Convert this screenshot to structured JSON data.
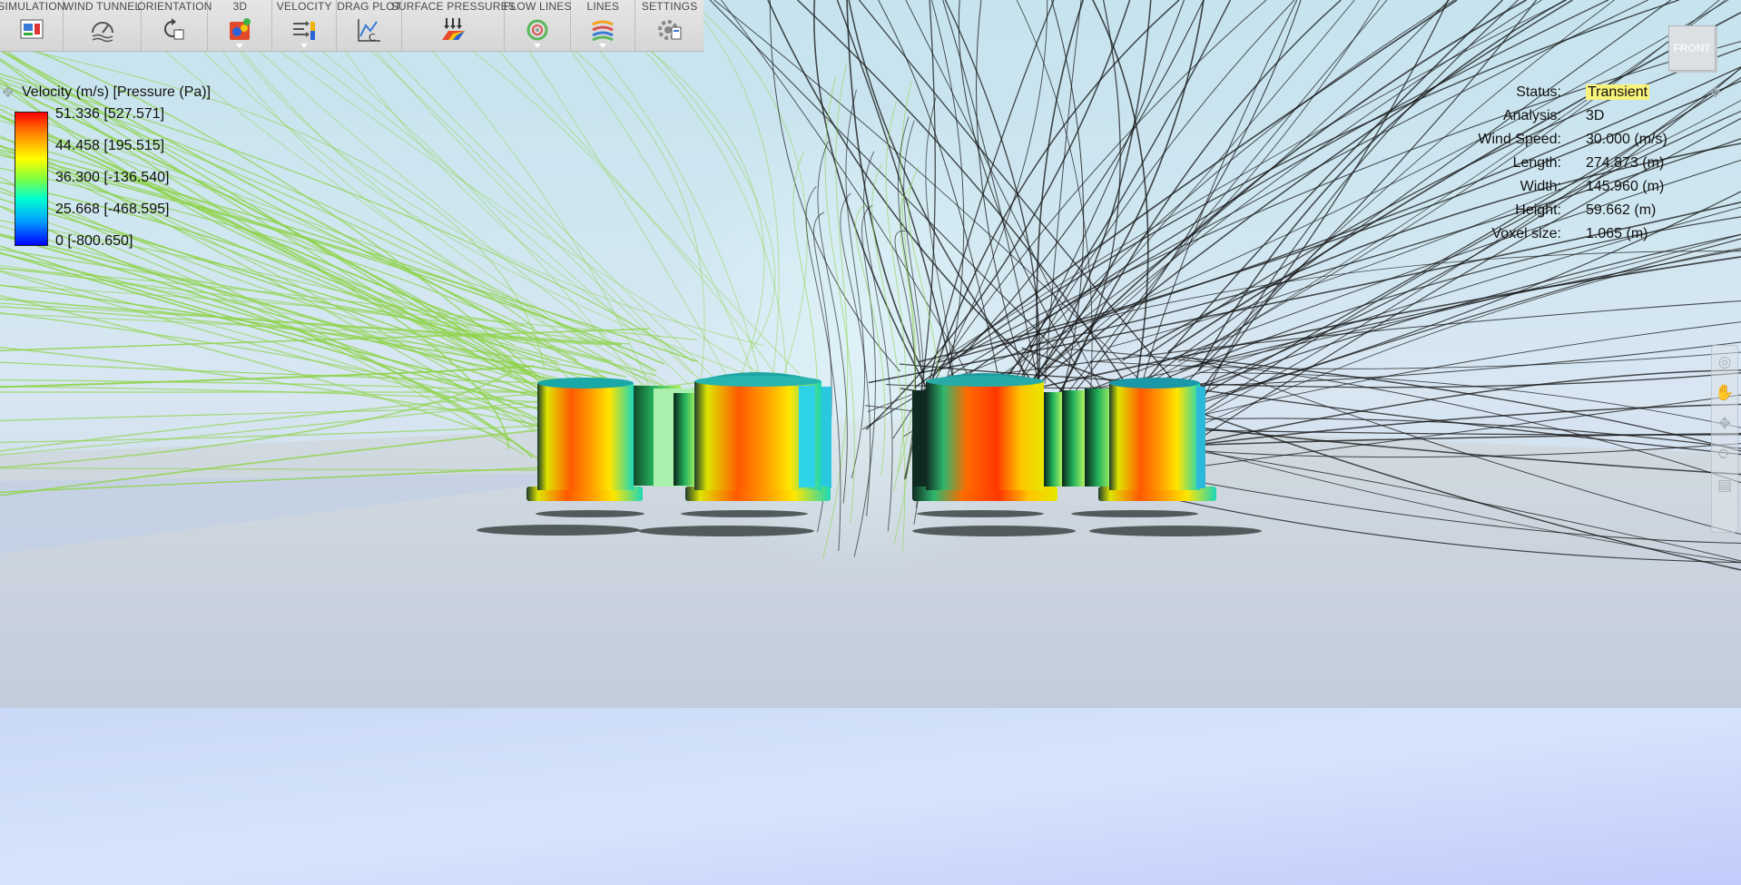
{
  "toolbar": {
    "items": [
      {
        "label": "SIMULATION",
        "icon": "simulation-icon",
        "dropdown": false
      },
      {
        "label": "WIND TUNNEL",
        "icon": "wind-tunnel-icon",
        "dropdown": false
      },
      {
        "label": "ORIENTATION",
        "icon": "orientation-icon",
        "dropdown": false
      },
      {
        "label": "3D",
        "icon": "3d-icon",
        "dropdown": true
      },
      {
        "label": "VELOCITY",
        "icon": "velocity-icon",
        "dropdown": true
      },
      {
        "label": "DRAG PLOT",
        "icon": "drag-plot-icon",
        "dropdown": false
      },
      {
        "label": "SURFACE PRESSURES",
        "icon": "surface-pressures-icon",
        "dropdown": false
      },
      {
        "label": "FLOW LINES",
        "icon": "flow-lines-icon",
        "dropdown": true
      },
      {
        "label": "LINES",
        "icon": "lines-icon",
        "dropdown": true
      },
      {
        "label": "SETTINGS",
        "icon": "settings-icon",
        "dropdown": false
      }
    ]
  },
  "legend": {
    "title": "Velocity (m/s) [Pressure (Pa)]",
    "ticks": [
      "51.336 [527.571]",
      "44.458 [195.515]",
      "36.300 [-136.540]",
      "25.668 [-468.595]",
      "0 [-800.650]"
    ],
    "colors": [
      "#ff0000",
      "#ffff00",
      "#00ffd0",
      "#0000ff"
    ]
  },
  "status": {
    "rows": [
      {
        "label": "Status:",
        "value": "Transient",
        "highlight": true
      },
      {
        "label": "Analysis:",
        "value": "3D"
      },
      {
        "label": "Wind Speed:",
        "value": "30.000 (m/s)"
      },
      {
        "label": "Length:",
        "value": "274.873 (m)"
      },
      {
        "label": "Width:",
        "value": "145.960 (m)"
      },
      {
        "label": "Height:",
        "value": "59.662 (m)"
      },
      {
        "label": "Voxel size:",
        "value": "1.065 (m)"
      }
    ]
  },
  "viewcube": {
    "face": "FRONT"
  },
  "colors": {
    "toolbar_bg": "#dcdcdc",
    "highlight": "#f6f27a",
    "flowline_green": "#8fd34a",
    "flowline_black": "#111111"
  }
}
